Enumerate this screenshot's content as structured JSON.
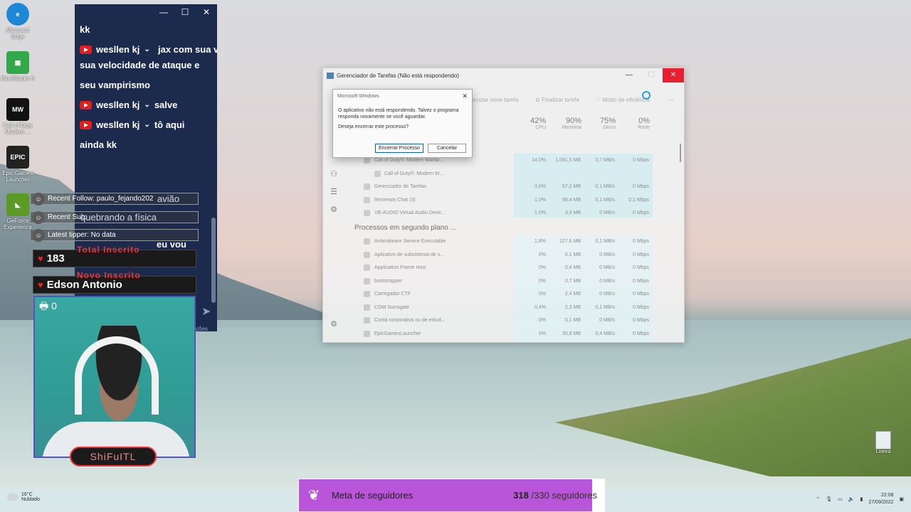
{
  "desktop": {
    "icons": [
      {
        "label": "Microsoft Edge",
        "color": "#1e88d6"
      },
      {
        "label": "BlueStacks 5",
        "color": "#33a84b"
      },
      {
        "label": "Call of Duty Modern ...",
        "color": "#111111"
      },
      {
        "label": "Epic Games Launcher",
        "color": "#222222"
      },
      {
        "label": "GeForce Experience",
        "color": "#5b9a25"
      }
    ],
    "recycle_bin": "Lixeira"
  },
  "chat": {
    "messages": [
      {
        "text": "kk"
      },
      {
        "user": "wesllen kj",
        "text": "jax com sua velocidade de ataque e seu vampirismo"
      },
      {
        "user": "wesllen kj",
        "text": "salve"
      },
      {
        "user": "wesllen kj",
        "text": "tô aqui ainda kk"
      },
      {
        "user": "wesllen kj",
        "text": "eu vou"
      }
    ],
    "ghost_1": "avião",
    "ghost_2": "quebrando a física",
    "settings_label": "ções"
  },
  "overlay": {
    "recent_follow": "Recent Follow: paulo_fejando202",
    "recent_sub": "Recent Sub:",
    "latest_tipper": "Latest tipper: No data",
    "total_label": "Total Inscrito",
    "total_value": "183",
    "new_label": "Novo Inscrito",
    "new_value": "Edson Antonio",
    "cam_count": "0",
    "streamer": "ShiFuITL"
  },
  "task_manager": {
    "title": "Gerenciador de Tarefas (Não está respondendo)",
    "toolbar": {
      "run_new": "ecutar nova tarefa",
      "end_task": "Finalizar tarefa",
      "efficiency": "Modo de eficiência"
    },
    "columns": [
      {
        "pct": "42%",
        "label": "CPU"
      },
      {
        "pct": "90%",
        "label": "Memória"
      },
      {
        "pct": "75%",
        "label": "Disco"
      },
      {
        "pct": "0%",
        "label": "Rede"
      }
    ],
    "apps": [
      {
        "name": "Call of Duty®: Modern Warfar...",
        "cpu": "14,0%",
        "mem": "1.081,5 MB",
        "disk": "0,7 MB/s",
        "net": "0 Mbps"
      },
      {
        "name": "Call of Duty®: Modern W...",
        "cpu": "",
        "mem": "",
        "disk": "",
        "net": ""
      },
      {
        "name": "Gerenciador de Tarefas",
        "cpu": "3,6%",
        "mem": "57,2 MB",
        "disk": "0,1 MB/s",
        "net": "0 Mbps"
      },
      {
        "name": "Restream Chat (3)",
        "cpu": "1,0%",
        "mem": "98,4 MB",
        "disk": "0,1 MB/s",
        "net": "0,1 Mbps"
      },
      {
        "name": "VB-AUDIO Virtual Audio Devic...",
        "cpu": "1,0%",
        "mem": "3,9 MB",
        "disk": "0 MB/s",
        "net": "0 Mbps"
      }
    ],
    "background_title": "Processos em segundo plano ...",
    "background": [
      {
        "name": "Antimalware Service Executable",
        "cpu": "1,8%",
        "mem": "127,6 MB",
        "disk": "0,1 MB/s",
        "net": "0 Mbps"
      },
      {
        "name": "Aplicativo de subsistema de s...",
        "cpu": "0%",
        "mem": "0,1 MB",
        "disk": "0 MB/s",
        "net": "0 Mbps"
      },
      {
        "name": "Application Frame Host",
        "cpu": "0%",
        "mem": "0,4 MB",
        "disk": "0 MB/s",
        "net": "0 Mbps"
      },
      {
        "name": "bootstrapper",
        "cpu": "0%",
        "mem": "0,7 MB",
        "disk": "0 MB/s",
        "net": "0 Mbps"
      },
      {
        "name": "Carregador CTF",
        "cpu": "0%",
        "mem": "2,4 MB",
        "disk": "0 MB/s",
        "net": "0 Mbps"
      },
      {
        "name": "COM Surrogate",
        "cpu": "0,4%",
        "mem": "2,3 MB",
        "disk": "0,1 MB/s",
        "net": "0 Mbps"
      },
      {
        "name": "Conta corporativa ou de estud...",
        "cpu": "0%",
        "mem": "0,1 MB",
        "disk": "0 MB/s",
        "net": "0 Mbps"
      },
      {
        "name": "EpicGamesLauncher",
        "cpu": "0%",
        "mem": "30,9 MB",
        "disk": "0,4 MB/s",
        "net": "0 Mbps"
      }
    ]
  },
  "dialog": {
    "title": "Microsoft Windows",
    "body": "O aplicativo não está respondendo. Talvez o programa responda novamente se você aguardar.",
    "question": "Deseja encerrar este processo?",
    "end_button": "Encerrar Processo",
    "cancel_button": "Cancelar"
  },
  "goal": {
    "label": "Meta de seguidores",
    "current": "318",
    "target": "/330 seguidores",
    "progress": 0.96
  },
  "taskbar": {
    "temp": "16°C",
    "weather": "Nublado",
    "time": "22:08",
    "date": "27/09/2022"
  }
}
